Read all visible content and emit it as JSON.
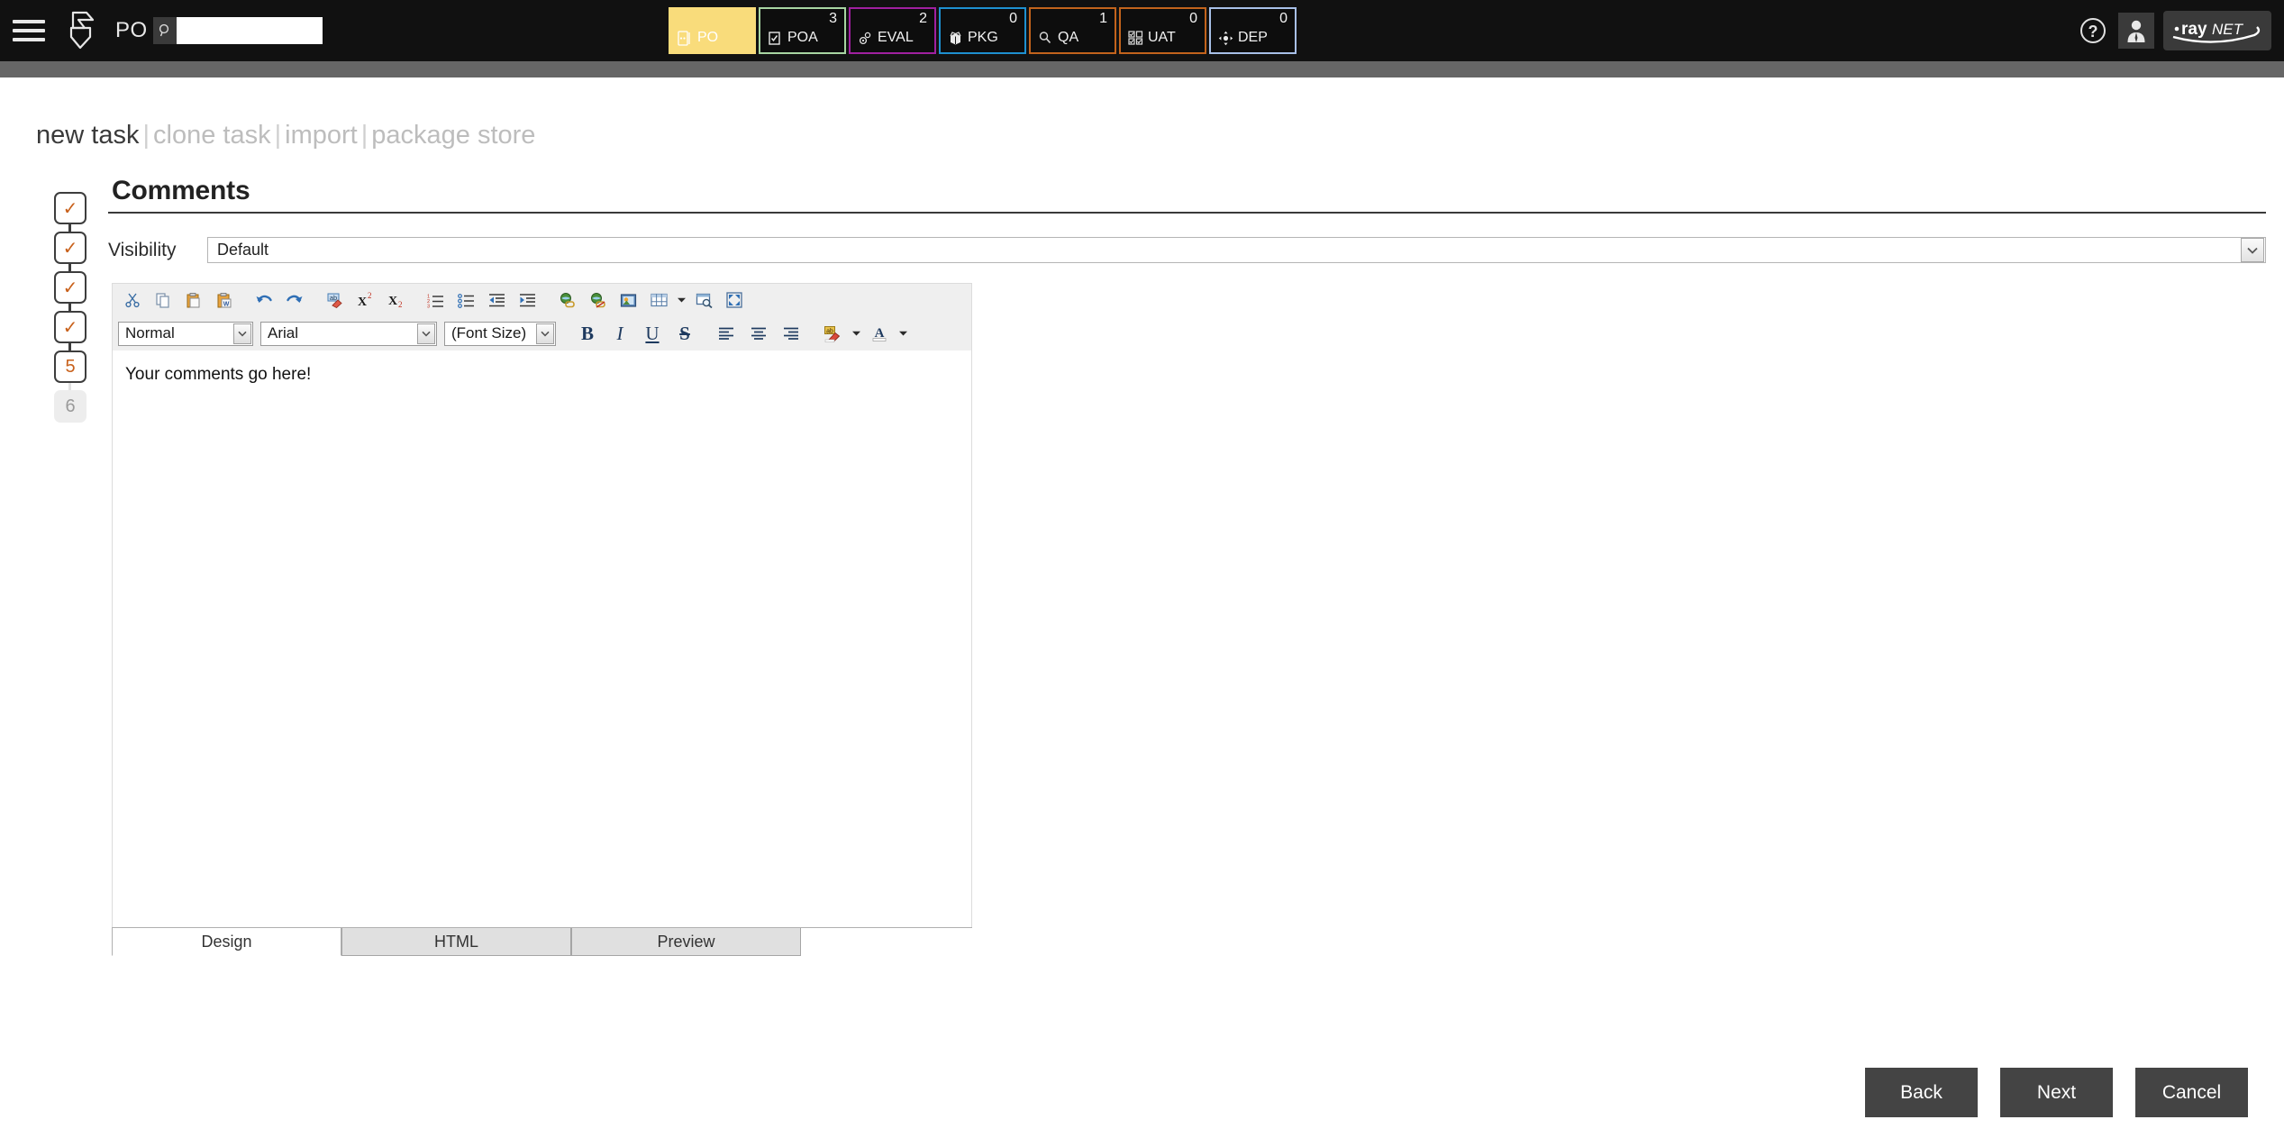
{
  "header": {
    "menu_icon": "hamburger-menu-icon",
    "brand_icon": "raynet-arrow-logo-icon",
    "module_label": "PO",
    "search": {
      "icon": "search-icon",
      "value": "",
      "placeholder": ""
    },
    "help_icon": "help-question-icon",
    "user_icon": "user-avatar-icon",
    "logo_text_dot": "•",
    "logo_text_ray": "ray",
    "logo_text_net": "NET"
  },
  "phase_tabs": [
    {
      "label": "PO",
      "count": "",
      "icon": "purchase-order-icon",
      "color": "#F9DC7B",
      "active": true
    },
    {
      "label": "POA",
      "count": "3",
      "icon": "checkbox-document-icon",
      "color": "#A8D5A2",
      "active": false
    },
    {
      "label": "EVAL",
      "count": "2",
      "icon": "gears-icon",
      "color": "#A020A0",
      "active": false
    },
    {
      "label": "PKG",
      "count": "0",
      "icon": "open-box-icon",
      "color": "#1E90D0",
      "active": false
    },
    {
      "label": "QA",
      "count": "1",
      "icon": "magnifier-icon",
      "color": "#C2631C",
      "active": false
    },
    {
      "label": "UAT",
      "count": "0",
      "icon": "checklist-grid-icon",
      "color": "#C2631C",
      "active": false
    },
    {
      "label": "DEP",
      "count": "0",
      "icon": "deploy-move-icon",
      "color": "#A8C0E8",
      "active": false
    }
  ],
  "breadcrumb": {
    "items": [
      {
        "label": "new task",
        "active": true
      },
      {
        "label": "clone task",
        "active": false
      },
      {
        "label": "import",
        "active": false
      },
      {
        "label": "package store",
        "active": false
      }
    ],
    "separator": "|"
  },
  "steps": [
    {
      "label": "✓",
      "state": "done"
    },
    {
      "label": "✓",
      "state": "done"
    },
    {
      "label": "✓",
      "state": "done"
    },
    {
      "label": "✓",
      "state": "done"
    },
    {
      "label": "5",
      "state": "current"
    },
    {
      "label": "6",
      "state": "disabled"
    }
  ],
  "main": {
    "title": "Comments",
    "visibility": {
      "label": "Visibility",
      "value": "Default",
      "options": [
        "Default"
      ]
    }
  },
  "editor": {
    "toolbar_row1": [
      {
        "name": "cut-icon",
        "title": "Cut"
      },
      {
        "name": "copy-icon",
        "title": "Copy"
      },
      {
        "name": "paste-icon",
        "title": "Paste"
      },
      {
        "name": "paste-from-word-icon",
        "title": "Paste from Word"
      },
      {
        "name": "undo-icon",
        "title": "Undo"
      },
      {
        "name": "redo-icon",
        "title": "Redo"
      },
      {
        "name": "remove-format-icon",
        "title": "Remove Format"
      },
      {
        "name": "superscript-icon",
        "title": "Superscript"
      },
      {
        "name": "subscript-icon",
        "title": "Subscript"
      },
      {
        "name": "numbered-list-icon",
        "title": "Insert/Remove Numbered List"
      },
      {
        "name": "bulleted-list-icon",
        "title": "Insert/Remove Bulleted List"
      },
      {
        "name": "decrease-indent-icon",
        "title": "Decrease Indent"
      },
      {
        "name": "increase-indent-icon",
        "title": "Increase Indent"
      },
      {
        "name": "link-icon",
        "title": "Link"
      },
      {
        "name": "unlink-icon",
        "title": "Unlink"
      },
      {
        "name": "image-icon",
        "title": "Image"
      },
      {
        "name": "table-icon",
        "title": "Table"
      },
      {
        "name": "find-icon",
        "title": "Find"
      },
      {
        "name": "maximize-icon",
        "title": "Maximize"
      }
    ],
    "style_select": {
      "value": "Normal",
      "name": "paragraph-format-select"
    },
    "font_select": {
      "value": "Arial",
      "name": "font-family-select"
    },
    "size_select": {
      "value": "(Font Size)",
      "name": "font-size-select"
    },
    "format_buttons": [
      {
        "name": "bold-button",
        "glyph": "B"
      },
      {
        "name": "italic-button",
        "glyph": "I"
      },
      {
        "name": "underline-button",
        "glyph": "U"
      },
      {
        "name": "strikethrough-button",
        "glyph": "S"
      }
    ],
    "align_buttons": [
      {
        "name": "align-left-button"
      },
      {
        "name": "align-center-button"
      },
      {
        "name": "align-right-button"
      }
    ],
    "highlight_button": {
      "name": "text-highlight-color-button"
    },
    "fontcolor_button": {
      "name": "font-color-button",
      "glyph": "A"
    },
    "content": "Your comments go here!",
    "mode_tabs": [
      {
        "label": "Design",
        "active": true
      },
      {
        "label": "HTML",
        "active": false
      },
      {
        "label": "Preview",
        "active": false
      }
    ]
  },
  "footer": {
    "buttons": [
      {
        "label": "Back",
        "name": "back-button"
      },
      {
        "label": "Next",
        "name": "next-button"
      },
      {
        "label": "Cancel",
        "name": "cancel-button"
      }
    ]
  }
}
